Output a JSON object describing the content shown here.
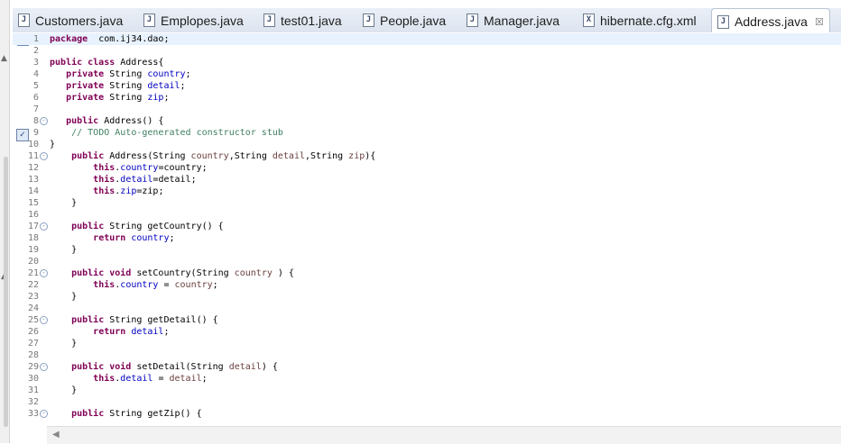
{
  "tabs": [
    {
      "label": "Customers.java",
      "icon": "java-file-icon"
    },
    {
      "label": "Emplopes.java",
      "icon": "java-file-icon"
    },
    {
      "label": "test01.java",
      "icon": "java-file-icon"
    },
    {
      "label": "People.java",
      "icon": "java-file-icon"
    },
    {
      "label": "Manager.java",
      "icon": "java-file-icon"
    },
    {
      "label": "hibernate.cfg.xml",
      "icon": "xml-file-icon"
    },
    {
      "label": "Address.java",
      "icon": "java-file-icon",
      "active": true,
      "close": "☒"
    }
  ],
  "editor": {
    "lines": [
      {
        "n": "1",
        "tokens": [
          [
            "kw",
            "package"
          ],
          [
            "",
            "  com.ij34.dao;"
          ]
        ]
      },
      {
        "n": "2",
        "tokens": []
      },
      {
        "n": "3",
        "tokens": [
          [
            "kw",
            "public"
          ],
          [
            "",
            ""
          ],
          [
            "kw",
            " class"
          ],
          [
            "",
            " Address{"
          ]
        ]
      },
      {
        "n": "4",
        "tokens": [
          [
            "",
            "   "
          ],
          [
            "kw",
            "private"
          ],
          [
            "",
            " String "
          ],
          [
            "fld",
            "country"
          ],
          [
            "",
            ";"
          ]
        ]
      },
      {
        "n": "5",
        "tokens": [
          [
            "",
            "   "
          ],
          [
            "kw",
            "private"
          ],
          [
            "",
            " String "
          ],
          [
            "fld",
            "detail"
          ],
          [
            "",
            ";"
          ]
        ]
      },
      {
        "n": "6",
        "tokens": [
          [
            "",
            "   "
          ],
          [
            "kw",
            "private"
          ],
          [
            "",
            " String "
          ],
          [
            "fld",
            "zip"
          ],
          [
            "",
            ";"
          ]
        ]
      },
      {
        "n": "7",
        "tokens": []
      },
      {
        "n": "8",
        "fold": true,
        "tokens": [
          [
            "",
            "   "
          ],
          [
            "kw",
            "public"
          ],
          [
            "",
            " Address() {"
          ]
        ]
      },
      {
        "n": "9",
        "tokens": [
          [
            "",
            "    "
          ],
          [
            "cmt",
            "// TODO Auto-generated constructor stub"
          ]
        ]
      },
      {
        "n": "10",
        "tokens": [
          [
            "",
            "}"
          ]
        ]
      },
      {
        "n": "11",
        "fold": true,
        "tokens": [
          [
            "",
            "    "
          ],
          [
            "kw",
            "public"
          ],
          [
            "",
            " Address(String "
          ],
          [
            "prm",
            "country"
          ],
          [
            "",
            ",String "
          ],
          [
            "prm",
            "detail"
          ],
          [
            "",
            ",String "
          ],
          [
            "prm",
            "zip"
          ],
          [
            "",
            "){"
          ]
        ]
      },
      {
        "n": "12",
        "tokens": [
          [
            "",
            "        "
          ],
          [
            "kw",
            "this"
          ],
          [
            "",
            "."
          ],
          [
            "fld",
            "country"
          ],
          [
            "",
            "=country;"
          ]
        ]
      },
      {
        "n": "13",
        "tokens": [
          [
            "",
            "        "
          ],
          [
            "kw",
            "this"
          ],
          [
            "",
            "."
          ],
          [
            "fld",
            "detail"
          ],
          [
            "",
            "=detail;"
          ]
        ]
      },
      {
        "n": "14",
        "tokens": [
          [
            "",
            "        "
          ],
          [
            "kw",
            "this"
          ],
          [
            "",
            "."
          ],
          [
            "fld",
            "zip"
          ],
          [
            "",
            "=zip;"
          ]
        ]
      },
      {
        "n": "15",
        "tokens": [
          [
            "",
            "    }"
          ]
        ]
      },
      {
        "n": "16",
        "tokens": []
      },
      {
        "n": "17",
        "fold": true,
        "tokens": [
          [
            "",
            "    "
          ],
          [
            "kw",
            "public"
          ],
          [
            "",
            " String getCountry() {"
          ]
        ]
      },
      {
        "n": "18",
        "tokens": [
          [
            "",
            "        "
          ],
          [
            "kw",
            "return"
          ],
          [
            "",
            " "
          ],
          [
            "fld",
            "country"
          ],
          [
            "",
            ";"
          ]
        ]
      },
      {
        "n": "19",
        "tokens": [
          [
            "",
            "    }"
          ]
        ]
      },
      {
        "n": "20",
        "tokens": []
      },
      {
        "n": "21",
        "fold": true,
        "tokens": [
          [
            "",
            "    "
          ],
          [
            "kw",
            "public"
          ],
          [
            "kw",
            " void"
          ],
          [
            "",
            " setCountry(String "
          ],
          [
            "prm",
            "country"
          ],
          [
            "",
            " ) {"
          ]
        ]
      },
      {
        "n": "22",
        "tokens": [
          [
            "",
            "        "
          ],
          [
            "kw",
            "this"
          ],
          [
            "",
            "."
          ],
          [
            "fld",
            "country"
          ],
          [
            "",
            " = "
          ],
          [
            "prm",
            "country"
          ],
          [
            "",
            ";"
          ]
        ]
      },
      {
        "n": "23",
        "tokens": [
          [
            "",
            "    }"
          ]
        ]
      },
      {
        "n": "24",
        "tokens": []
      },
      {
        "n": "25",
        "fold": true,
        "tokens": [
          [
            "",
            "    "
          ],
          [
            "kw",
            "public"
          ],
          [
            "",
            " String getDetail() {"
          ]
        ]
      },
      {
        "n": "26",
        "tokens": [
          [
            "",
            "        "
          ],
          [
            "kw",
            "return"
          ],
          [
            "",
            " "
          ],
          [
            "fld",
            "detail"
          ],
          [
            "",
            ";"
          ]
        ]
      },
      {
        "n": "27",
        "tokens": [
          [
            "",
            "    }"
          ]
        ]
      },
      {
        "n": "28",
        "tokens": []
      },
      {
        "n": "29",
        "fold": true,
        "tokens": [
          [
            "",
            "    "
          ],
          [
            "kw",
            "public"
          ],
          [
            "kw",
            " void"
          ],
          [
            "",
            " setDetail(String "
          ],
          [
            "prm",
            "detail"
          ],
          [
            "",
            ") {"
          ]
        ]
      },
      {
        "n": "30",
        "tokens": [
          [
            "",
            "        "
          ],
          [
            "kw",
            "this"
          ],
          [
            "",
            "."
          ],
          [
            "fld",
            "detail"
          ],
          [
            "",
            " = "
          ],
          [
            "prm",
            "detail"
          ],
          [
            "",
            ";"
          ]
        ]
      },
      {
        "n": "31",
        "tokens": [
          [
            "",
            "    }"
          ]
        ]
      },
      {
        "n": "32",
        "tokens": []
      },
      {
        "n": "33",
        "fold": true,
        "tokens": [
          [
            "",
            "    "
          ],
          [
            "kw",
            "public"
          ],
          [
            "",
            " String getZip() {"
          ]
        ]
      }
    ]
  }
}
